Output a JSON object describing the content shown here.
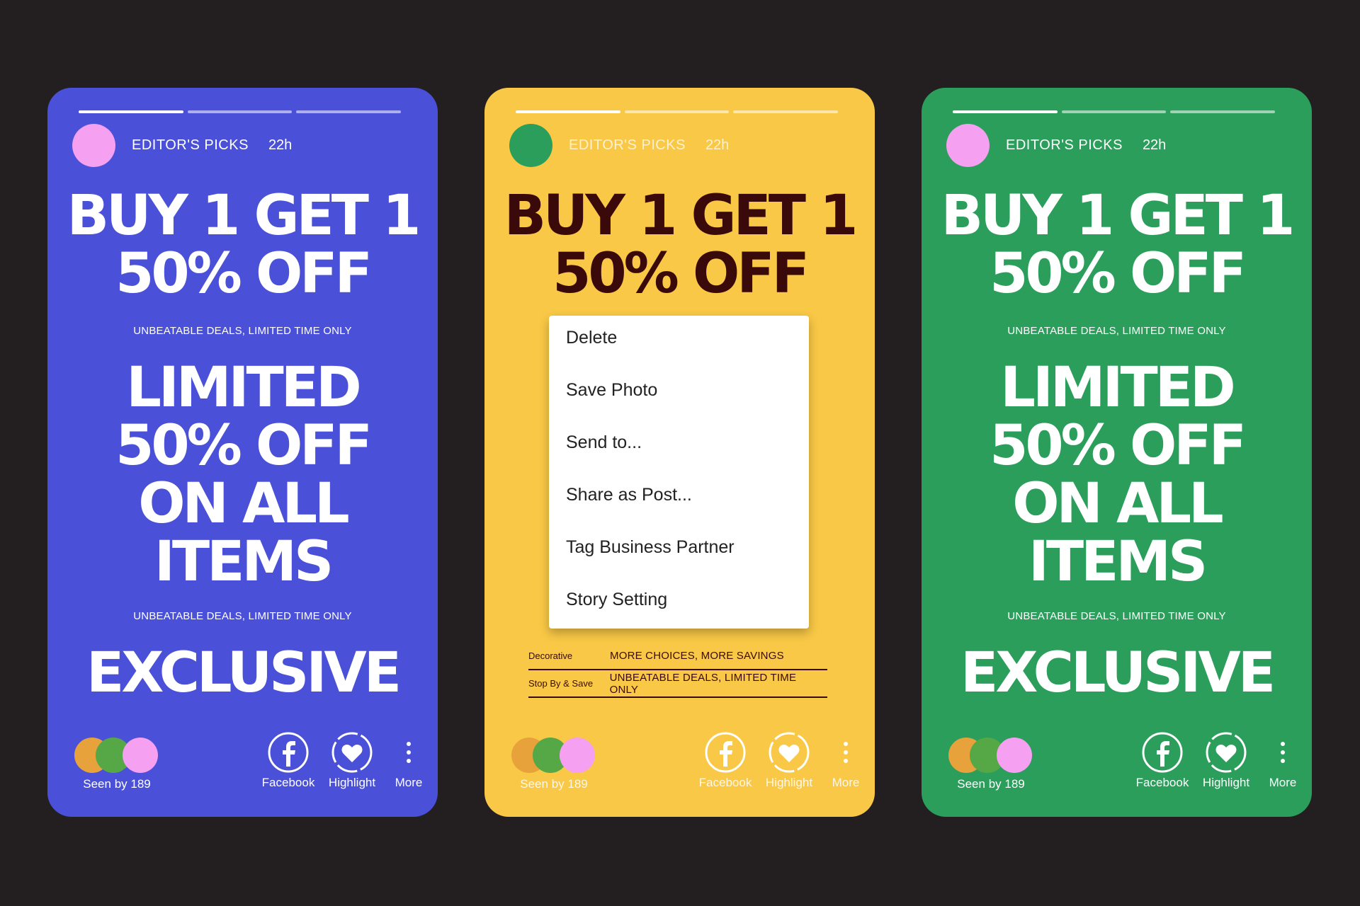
{
  "colors": {
    "background": "#231f20",
    "blue": "#4a50d8",
    "yellow": "#f9c846",
    "green": "#2a9e5a",
    "dark_red": "#3a0a0a",
    "pink": "#f5a0f0",
    "orange": "#e8a23c",
    "green_dot": "#55a845"
  },
  "story": {
    "username": "EDITOR'S PICKS",
    "time": "22h",
    "headline_line1": "BUY 1 GET 1",
    "headline_line2": "50% OFF",
    "tagline": "UNBEATABLE DEALS, LIMITED TIME ONLY",
    "limited_line1": "LIMITED",
    "limited_line2": "50% OFF",
    "limited_line3": "ON ALL",
    "limited_line4": "ITEMS",
    "exclusive": "EXCLUSIVE",
    "seen_by": "Seen by 189",
    "actions": {
      "facebook": "Facebook",
      "highlight": "Highlight",
      "more": "More"
    }
  },
  "context_menu": {
    "items": [
      "Delete",
      "Save Photo",
      "Send to...",
      "Share as Post...",
      "Tag Business Partner",
      "Story Setting"
    ]
  },
  "info_rows": [
    {
      "key": "Decorative",
      "value": "MORE CHOICES, MORE SAVINGS"
    },
    {
      "key": "Stop By & Save",
      "value": "UNBEATABLE DEALS, LIMITED TIME ONLY"
    }
  ]
}
